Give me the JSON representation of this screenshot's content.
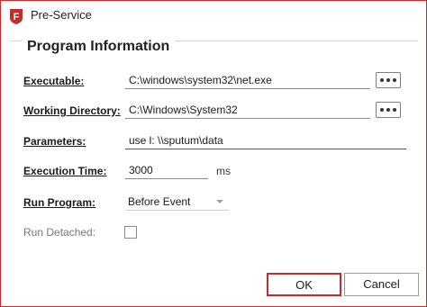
{
  "window": {
    "title": "Pre-Service",
    "accent_color": "#c42b2b",
    "icon": "app-logo-icon"
  },
  "section": {
    "title": "Program Information"
  },
  "fields": {
    "executable": {
      "label": "Executable:",
      "value": "C:\\windows\\system32\\net.exe"
    },
    "working_directory": {
      "label": "Working Directory:",
      "value": "C:\\Windows\\System32"
    },
    "parameters": {
      "label": "Parameters:",
      "value": "use l: \\\\sputum\\data"
    },
    "execution_time": {
      "label": "Execution Time:",
      "value": "3000",
      "unit": "ms"
    },
    "run_program": {
      "label": "Run Program:",
      "value": "Before Event"
    },
    "run_detached": {
      "label": "Run Detached:",
      "checked": false
    }
  },
  "buttons": {
    "ok": "OK",
    "cancel": "Cancel"
  }
}
